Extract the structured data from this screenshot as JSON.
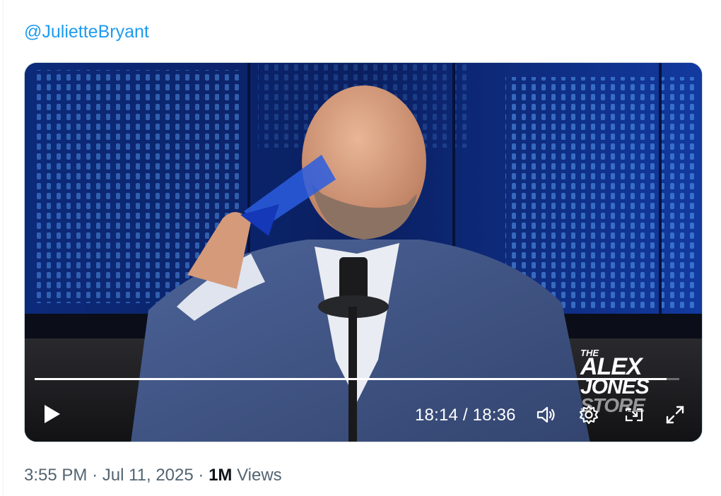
{
  "tweet": {
    "handle": "@JulietteBryant",
    "time": "3:55 PM",
    "sep1": "·",
    "date": "Jul 11, 2025",
    "sep2": "·",
    "views_count": "1M",
    "views_label": "Views"
  },
  "video": {
    "current_time": "18:14",
    "duration": "18:36",
    "time_display": "18:14 / 18:36",
    "progress_fraction": 0.98,
    "watermark": {
      "line1": "THE",
      "line2": "ALEX",
      "line3": "JONES",
      "line4": "STORE"
    },
    "controls": {
      "play_icon": "play-icon",
      "volume_icon": "speaker-icon",
      "settings_icon": "gear-icon",
      "cast_icon": "cast-icon",
      "fullscreen_icon": "fullscreen-icon"
    }
  },
  "colors": {
    "link": "#1d9bf0",
    "meta_text": "#536471",
    "strong_text": "#0f1419"
  }
}
